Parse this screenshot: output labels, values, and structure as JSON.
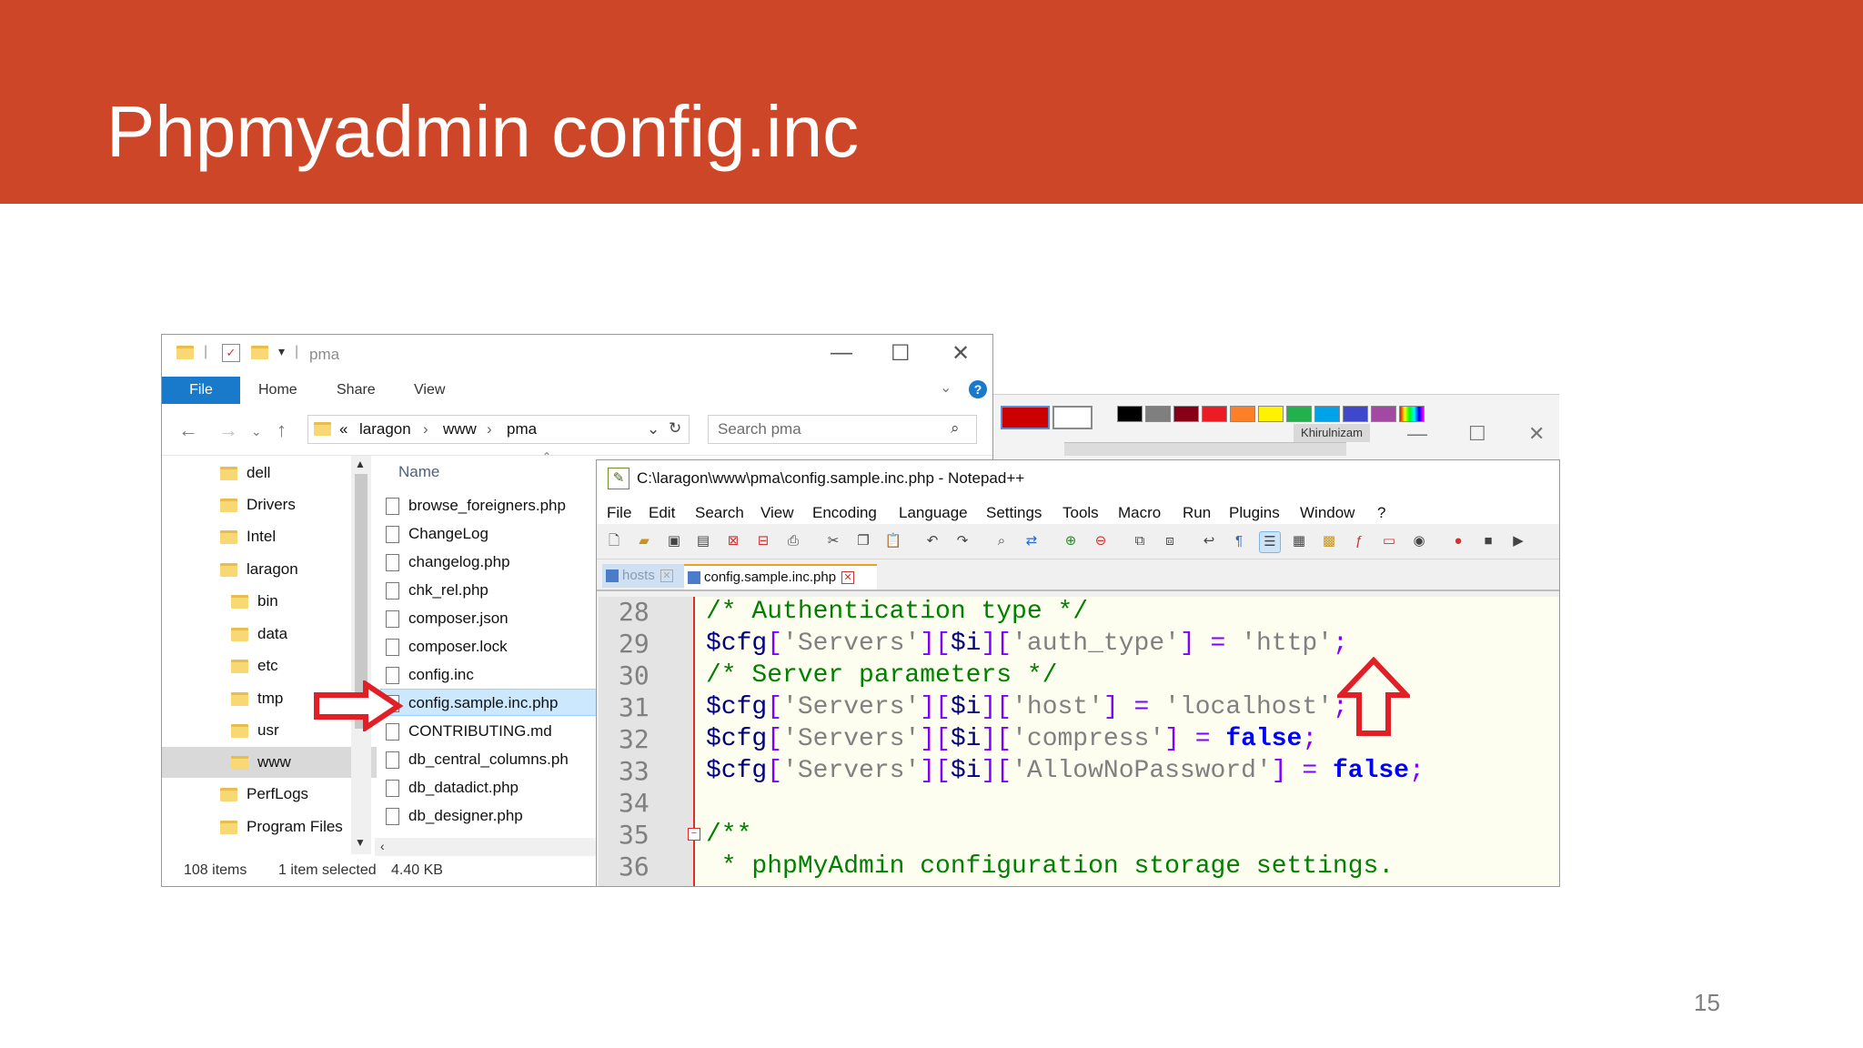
{
  "slide": {
    "title": "Phpmyadmin config.inc",
    "page_number": "15",
    "colors": {
      "header_bg": "#cd4628",
      "title": "#ffffff"
    }
  },
  "paint_window": {
    "user_label": "Khirulnizam",
    "palette": [
      "#cc0000",
      "#ffffff",
      "#000000",
      "#7f7f7f",
      "#880015",
      "#ed1c24",
      "#ff7f27",
      "#fff200",
      "#22b14c",
      "#00a2e8",
      "#3f48cc",
      "#a349a4"
    ]
  },
  "explorer": {
    "title": "pma",
    "ribbon": {
      "file": "File",
      "home": "Home",
      "share": "Share",
      "view": "View"
    },
    "address": {
      "prefix": "«",
      "parts": [
        "laragon",
        "www",
        "pma"
      ]
    },
    "search_placeholder": "Search pma",
    "tree": [
      "dell",
      "Drivers",
      "Intel",
      "laragon",
      "bin",
      "data",
      "etc",
      "tmp",
      "usr",
      "www",
      "PerfLogs",
      "Program Files"
    ],
    "column_name": "Name",
    "files": [
      "browse_foreigners.php",
      "ChangeLog",
      "changelog.php",
      "chk_rel.php",
      "composer.json",
      "composer.lock",
      "config.inc",
      "config.sample.inc.php",
      "CONTRIBUTING.md",
      "db_central_columns.ph",
      "db_datadict.php",
      "db_designer.php"
    ],
    "selected_file": "config.sample.inc.php",
    "status": {
      "items": "108 items",
      "selected": "1 item selected",
      "size": "4.40 KB"
    }
  },
  "notepad": {
    "title": "C:\\laragon\\www\\pma\\config.sample.inc.php - Notepad++",
    "menu": [
      "File",
      "Edit",
      "Search",
      "View",
      "Encoding",
      "Language",
      "Settings",
      "Tools",
      "Macro",
      "Run",
      "Plugins",
      "Window",
      "?"
    ],
    "tabs": [
      "hosts",
      "config.sample.inc.php"
    ],
    "lines": [
      {
        "n": "28"
      },
      {
        "n": "29"
      },
      {
        "n": "30"
      },
      {
        "n": "31"
      },
      {
        "n": "32"
      },
      {
        "n": "33"
      },
      {
        "n": "34"
      },
      {
        "n": "35"
      },
      {
        "n": "36"
      }
    ],
    "code": {
      "l28": "/* Authentication type */",
      "l29_var": "$cfg",
      "l29_a": "[",
      "l29_s1": "'Servers'",
      "l29_b": "][",
      "l29_i": "$i",
      "l29_c": "][",
      "l29_s2": "'auth_type'",
      "l29_d": "] = ",
      "l29_s3": "'http'",
      "l29_e": ";",
      "l30": "/* Server parameters */",
      "l31_var": "$cfg",
      "l31_a": "[",
      "l31_s1": "'Servers'",
      "l31_b": "][",
      "l31_i": "$i",
      "l31_c": "][",
      "l31_s2": "'host'",
      "l31_d": "] = ",
      "l31_s3": "'localhost'",
      "l31_e": ";",
      "l32_var": "$cfg",
      "l32_a": "[",
      "l32_s1": "'Servers'",
      "l32_b": "][",
      "l32_i": "$i",
      "l32_c": "][",
      "l32_s2": "'compress'",
      "l32_d": "] = ",
      "l32_kw": "false",
      "l32_e": ";",
      "l33_var": "$cfg",
      "l33_a": "[",
      "l33_s1": "'Servers'",
      "l33_b": "][",
      "l33_i": "$i",
      "l33_c": "][",
      "l33_s2": "'AllowNoPassword'",
      "l33_d": "] = ",
      "l33_kw": "false",
      "l33_e": ";",
      "l35": "/**",
      "l36": " * phpMyAdmin configuration storage settings."
    }
  }
}
